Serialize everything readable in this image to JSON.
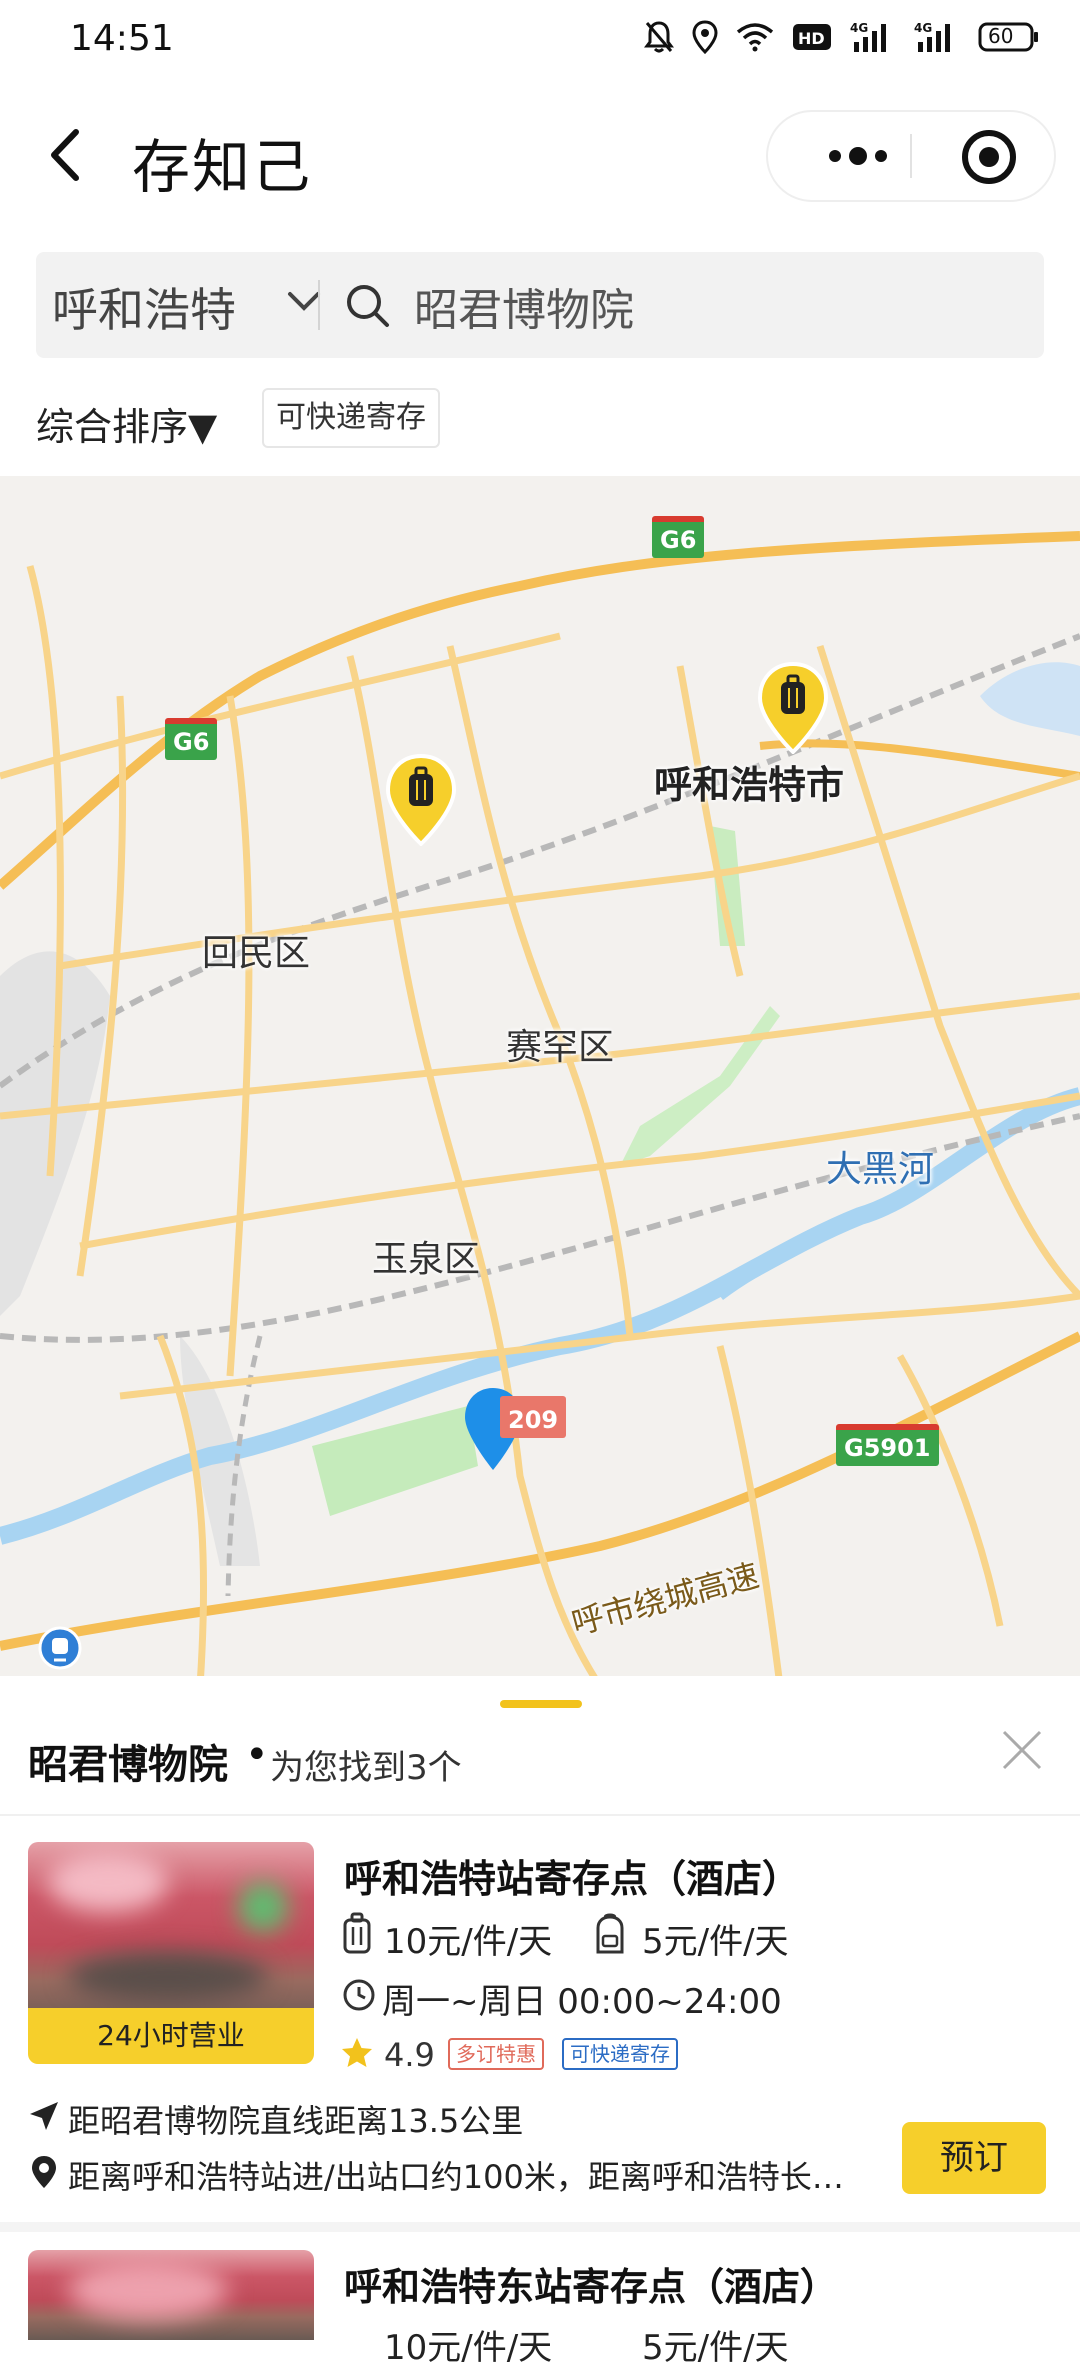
{
  "status": {
    "time": "14:51",
    "battery": "60"
  },
  "header": {
    "title": "存知己"
  },
  "search": {
    "city": "呼和浩特",
    "query": "昭君博物院"
  },
  "filters": {
    "sort_label": "综合排序▼",
    "chip": "可快递寄存"
  },
  "map": {
    "labels": {
      "huhehaote_city": "呼和浩特市",
      "huimin": "回民区",
      "saihan": "赛罕区",
      "yuquan": "玉泉区",
      "daheihe": "大黑河",
      "ring_road": "呼市绕城高速"
    },
    "shields": {
      "g6_top": "G6",
      "g6_left": "G6",
      "g5901": "G5901",
      "road_209": "209"
    }
  },
  "results": {
    "title": "昭君博物院",
    "dot": "•",
    "count_text": "为您找到3个",
    "items": [
      {
        "name": "呼和浩特站寄存点（酒店）",
        "badge": "24小时营业",
        "price_luggage": "10元/件/天",
        "price_bag": "5元/件/天",
        "hours": "周一~周日 00:00~24:00",
        "rating": "4.9",
        "tags": [
          "多订特惠",
          "可快递寄存"
        ],
        "distance": "距昭君博物院直线距离13.5公里",
        "address": "距离呼和浩特站进/出站口约100米，距离呼和浩特长…",
        "book_label": "预订"
      },
      {
        "name": "呼和浩特东站寄存点（酒店）",
        "price_luggage": "10元/件/天",
        "price_bag": "5元/件/天"
      }
    ]
  },
  "colors": {
    "accent": "#f6cf2b",
    "road": "#f7c96a",
    "river": "#a6d4f2",
    "park": "#bfe9b5"
  }
}
